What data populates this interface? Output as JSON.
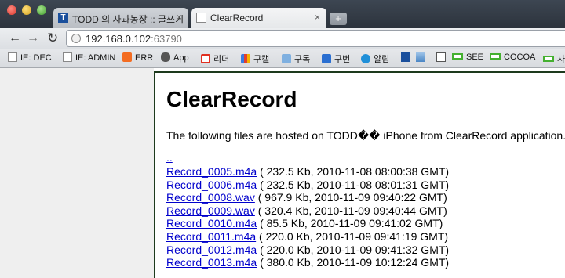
{
  "tabs": [
    {
      "label": "TODD 의 사과농장 :: 글쓰기",
      "close": "×"
    },
    {
      "label": "ClearRecord",
      "close": "×"
    }
  ],
  "new_tab": "+",
  "nav": {
    "back": "←",
    "forward": "→",
    "reload": "↻"
  },
  "address": {
    "host": "192.168.0.102",
    "port": ":63790"
  },
  "bookmarks": [
    {
      "label": "IE: DEC",
      "icon": "doc-icon"
    },
    {
      "label": "IE: ADMIN",
      "icon": "doc-icon"
    },
    {
      "label": "ERR",
      "icon": "gear-icon"
    },
    {
      "label": "App",
      "icon": "apple-icon"
    },
    {
      "label": "리더",
      "icon": "reader-icon"
    },
    {
      "label": "구캘",
      "icon": "google-calendar-icon"
    },
    {
      "label": "구독",
      "icon": "subscribe-icon"
    },
    {
      "label": "구번",
      "icon": "translate-icon"
    },
    {
      "label": "알림",
      "icon": "alarm-icon"
    },
    {
      "label": "",
      "icon": "t-icon"
    },
    {
      "label": "",
      "icon": "image-icon"
    },
    {
      "label": "",
      "icon": "info-icon"
    },
    {
      "label": "SEE",
      "icon": "green-bookmark-icon"
    },
    {
      "label": "COCOA",
      "icon": "green-bookmark-icon"
    },
    {
      "label": "사",
      "icon": "green-bookmark-icon"
    }
  ],
  "page": {
    "title": "ClearRecord",
    "intro": "The following files are hosted on TODD�� iPhone from ClearRecord application.",
    "parent_link": "..",
    "files": [
      {
        "name": "Record_0005.m4a",
        "info": " ( 232.5 Kb, 2010-11-08 08:00:38 GMT)"
      },
      {
        "name": "Record_0006.m4a",
        "info": " ( 232.5 Kb, 2010-11-08 08:01:31 GMT)"
      },
      {
        "name": "Record_0008.wav",
        "info": " ( 967.9 Kb, 2010-11-09 09:40:22 GMT)"
      },
      {
        "name": "Record_0009.wav",
        "info": " ( 320.4 Kb, 2010-11-09 09:40:44 GMT)"
      },
      {
        "name": "Record_0010.m4a",
        "info": " ( 85.5 Kb, 2010-11-09 09:41:02 GMT)"
      },
      {
        "name": "Record_0011.m4a",
        "info": " ( 220.0 Kb, 2010-11-09 09:41:19 GMT)"
      },
      {
        "name": "Record_0012.m4a",
        "info": " ( 220.0 Kb, 2010-11-09 09:41:32 GMT)"
      },
      {
        "name": "Record_0013.m4a",
        "info": " ( 380.0 Kb, 2010-11-09 10:12:24 GMT)"
      }
    ]
  }
}
